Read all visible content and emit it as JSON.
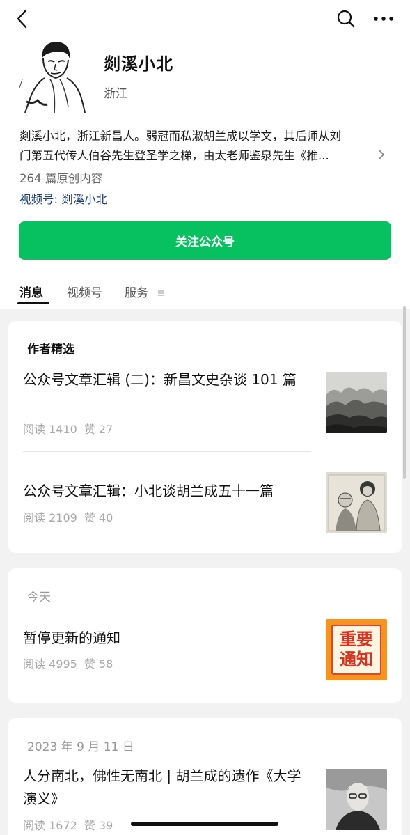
{
  "account": {
    "name": "剡溪小北",
    "region": "浙江",
    "bio_line1": "剡溪小北，浙江新昌人。弱冠而私淑胡兰成以学文，其后师从刘",
    "bio_line2": "门第五代传人伯谷先生登圣学之梯，由太老师鉴泉先生《推...",
    "original_count": "264 篇原创内容",
    "channel": "视频号: 剡溪小北",
    "follow_label": "关注公众号"
  },
  "icons": {
    "back": "chevron-left-icon",
    "search": "search-icon",
    "more": "more-dots-icon",
    "menu": "menu-lines-icon"
  },
  "colors": {
    "accent": "#07c160",
    "link": "#1d3f7a",
    "feed_bg": "#f2f2f2"
  },
  "tabs": [
    {
      "label": "消息",
      "active": true
    },
    {
      "label": "视频号",
      "active": false
    },
    {
      "label": "服务",
      "active": false
    }
  ],
  "featured": {
    "title": "作者精选",
    "articles": [
      {
        "title": "公众号文章汇辑 (二)：新昌文史杂谈 101 篇",
        "reads": "阅读 1410",
        "likes": "赞 27"
      },
      {
        "title": "公众号文章汇辑：小北谈胡兰成五十一篇",
        "reads": "阅读 2109",
        "likes": "赞 40"
      }
    ]
  },
  "today": {
    "date": "今天",
    "articles": [
      {
        "title": "暂停更新的通知",
        "reads": "阅读 4995",
        "likes": "赞 58",
        "thumb_line1": "重要",
        "thumb_line2": "通知"
      }
    ]
  },
  "dated": {
    "date": "2023 年 9 月 11 日",
    "articles": [
      {
        "title": "人分南北，佛性无南北 | 胡兰成的遗作《大学演义》",
        "reads": "阅读 1672",
        "likes": "赞 39"
      }
    ]
  }
}
